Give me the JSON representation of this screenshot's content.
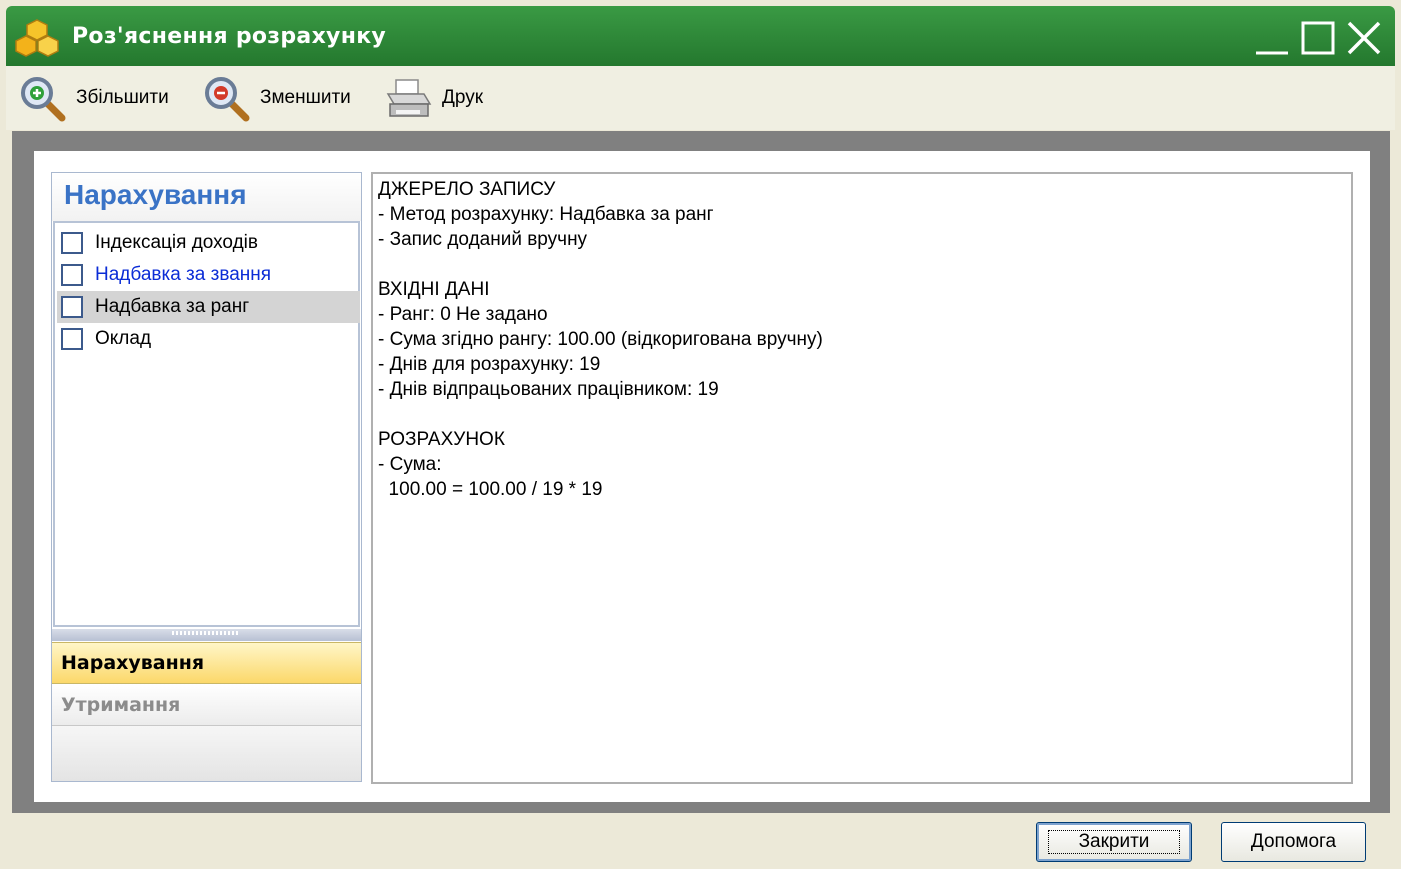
{
  "window": {
    "title": "Роз'яснення розрахунку",
    "accent_color": "#2f8a3a",
    "controls": [
      "minimize-icon",
      "maximize-icon",
      "close-icon"
    ]
  },
  "toolbar": {
    "zoom_in_label": "Збільшити",
    "zoom_out_label": "Зменшити",
    "print_label": "Друк"
  },
  "nav": {
    "header": "Нарахування",
    "items": [
      {
        "label": "Індексація доходів",
        "checked": false
      },
      {
        "label": "Надбавка за звання",
        "checked": false
      },
      {
        "label": "Надбавка за ранг",
        "checked": false,
        "selected": true
      },
      {
        "label": "Оклад",
        "checked": false
      }
    ],
    "sections": [
      {
        "label": "Нарахування",
        "active": true
      },
      {
        "label": "Утримання",
        "active": false
      }
    ]
  },
  "details": {
    "lines": [
      "ДЖЕРЕЛО ЗАПИСУ",
      "- Метод розрахунку: Надбавка за ранг",
      "- Запис доданий вручну",
      "",
      "ВХІДНІ ДАНІ",
      "- Ранг: 0 Не задано",
      "- Сума згідно рангу: 100.00 (відкоригована вручну)",
      "- Днів для розрахунку: 19",
      "- Днів відпрацьованих працівником: 19",
      "",
      "РОЗРАХУНОК",
      "- Сума:",
      "  100.00 = 100.00 / 19 * 19"
    ]
  },
  "buttons": {
    "close_label": "Закрити",
    "help_label": "Допомога"
  }
}
